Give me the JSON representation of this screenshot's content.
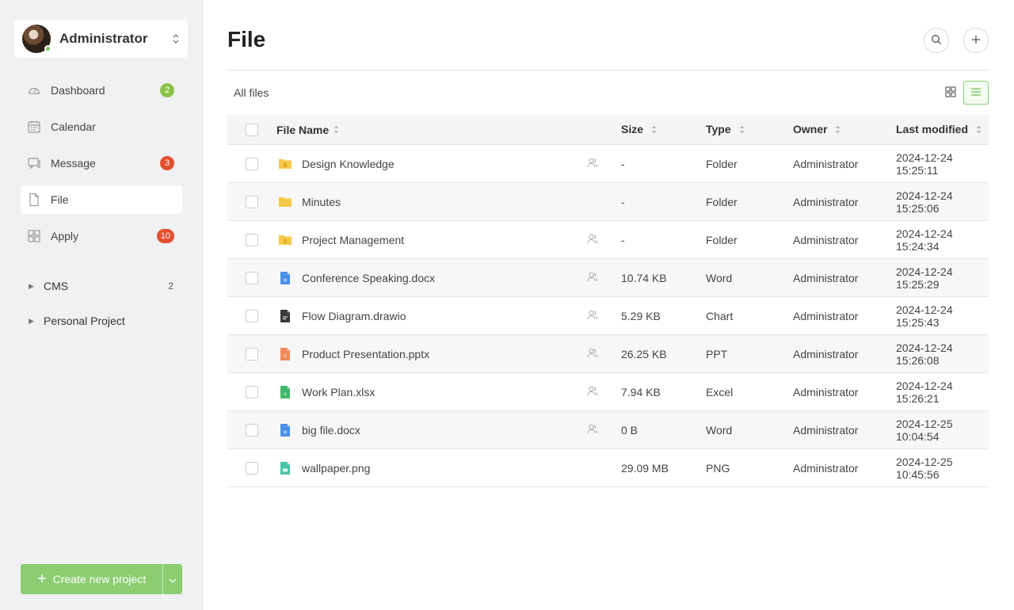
{
  "account": {
    "name": "Administrator"
  },
  "nav": [
    {
      "label": "Dashboard",
      "icon": "dashboard-icon",
      "badge": "2",
      "badge_color": "green",
      "active": false
    },
    {
      "label": "Calendar",
      "icon": "calendar-icon",
      "badge": null,
      "active": false
    },
    {
      "label": "Message",
      "icon": "message-icon",
      "badge": "3",
      "badge_color": "red",
      "active": false
    },
    {
      "label": "File",
      "icon": "file-icon",
      "badge": null,
      "active": true
    },
    {
      "label": "Apply",
      "icon": "apply-icon",
      "badge": "10",
      "badge_color": "red",
      "active": false
    }
  ],
  "groups": [
    {
      "label": "CMS",
      "count": "2"
    },
    {
      "label": "Personal Project",
      "count": ""
    }
  ],
  "create_button": {
    "label": "Create new project"
  },
  "page": {
    "title": "File",
    "breadcrumb": "All files"
  },
  "table": {
    "headers": {
      "name": "File Name",
      "size": "Size",
      "type": "Type",
      "owner": "Owner",
      "modified": "Last modified"
    },
    "rows": [
      {
        "name": "Design Knowledge",
        "icon": "shared-folder",
        "shared": true,
        "size": "-",
        "type": "Folder",
        "owner": "Administrator",
        "modified": "2024-12-24 15:25:11"
      },
      {
        "name": "Minutes",
        "icon": "folder",
        "shared": false,
        "size": "-",
        "type": "Folder",
        "owner": "Administrator",
        "modified": "2024-12-24 15:25:06"
      },
      {
        "name": "Project Management",
        "icon": "shared-folder",
        "shared": true,
        "size": "-",
        "type": "Folder",
        "owner": "Administrator",
        "modified": "2024-12-24 15:24:34"
      },
      {
        "name": "Conference Speaking.docx",
        "icon": "word",
        "shared": true,
        "size": "10.74 KB",
        "type": "Word",
        "owner": "Administrator",
        "modified": "2024-12-24 15:25:29"
      },
      {
        "name": "Flow Diagram.drawio",
        "icon": "chart",
        "shared": true,
        "size": "5.29 KB",
        "type": "Chart",
        "owner": "Administrator",
        "modified": "2024-12-24 15:25:43"
      },
      {
        "name": "Product Presentation.pptx",
        "icon": "ppt",
        "shared": true,
        "size": "26.25 KB",
        "type": "PPT",
        "owner": "Administrator",
        "modified": "2024-12-24 15:26:08"
      },
      {
        "name": "Work Plan.xlsx",
        "icon": "excel",
        "shared": true,
        "size": "7.94 KB",
        "type": "Excel",
        "owner": "Administrator",
        "modified": "2024-12-24 15:26:21"
      },
      {
        "name": "big file.docx",
        "icon": "word",
        "shared": true,
        "size": "0 B",
        "type": "Word",
        "owner": "Administrator",
        "modified": "2024-12-25 10:04:54"
      },
      {
        "name": "wallpaper.png",
        "icon": "png",
        "shared": false,
        "size": "29.09 MB",
        "type": "PNG",
        "owner": "Administrator",
        "modified": "2024-12-25 10:45:56"
      }
    ]
  },
  "colors": {
    "accent": "#8ccd72",
    "badge_green": "#8bc34a",
    "badge_red": "#e4502e",
    "folder": "#f7c948",
    "word": "#4a8fe7",
    "chart": "#3a3a3a",
    "ppt": "#f08a5d",
    "excel": "#3fb96a",
    "png": "#45c4a8"
  }
}
